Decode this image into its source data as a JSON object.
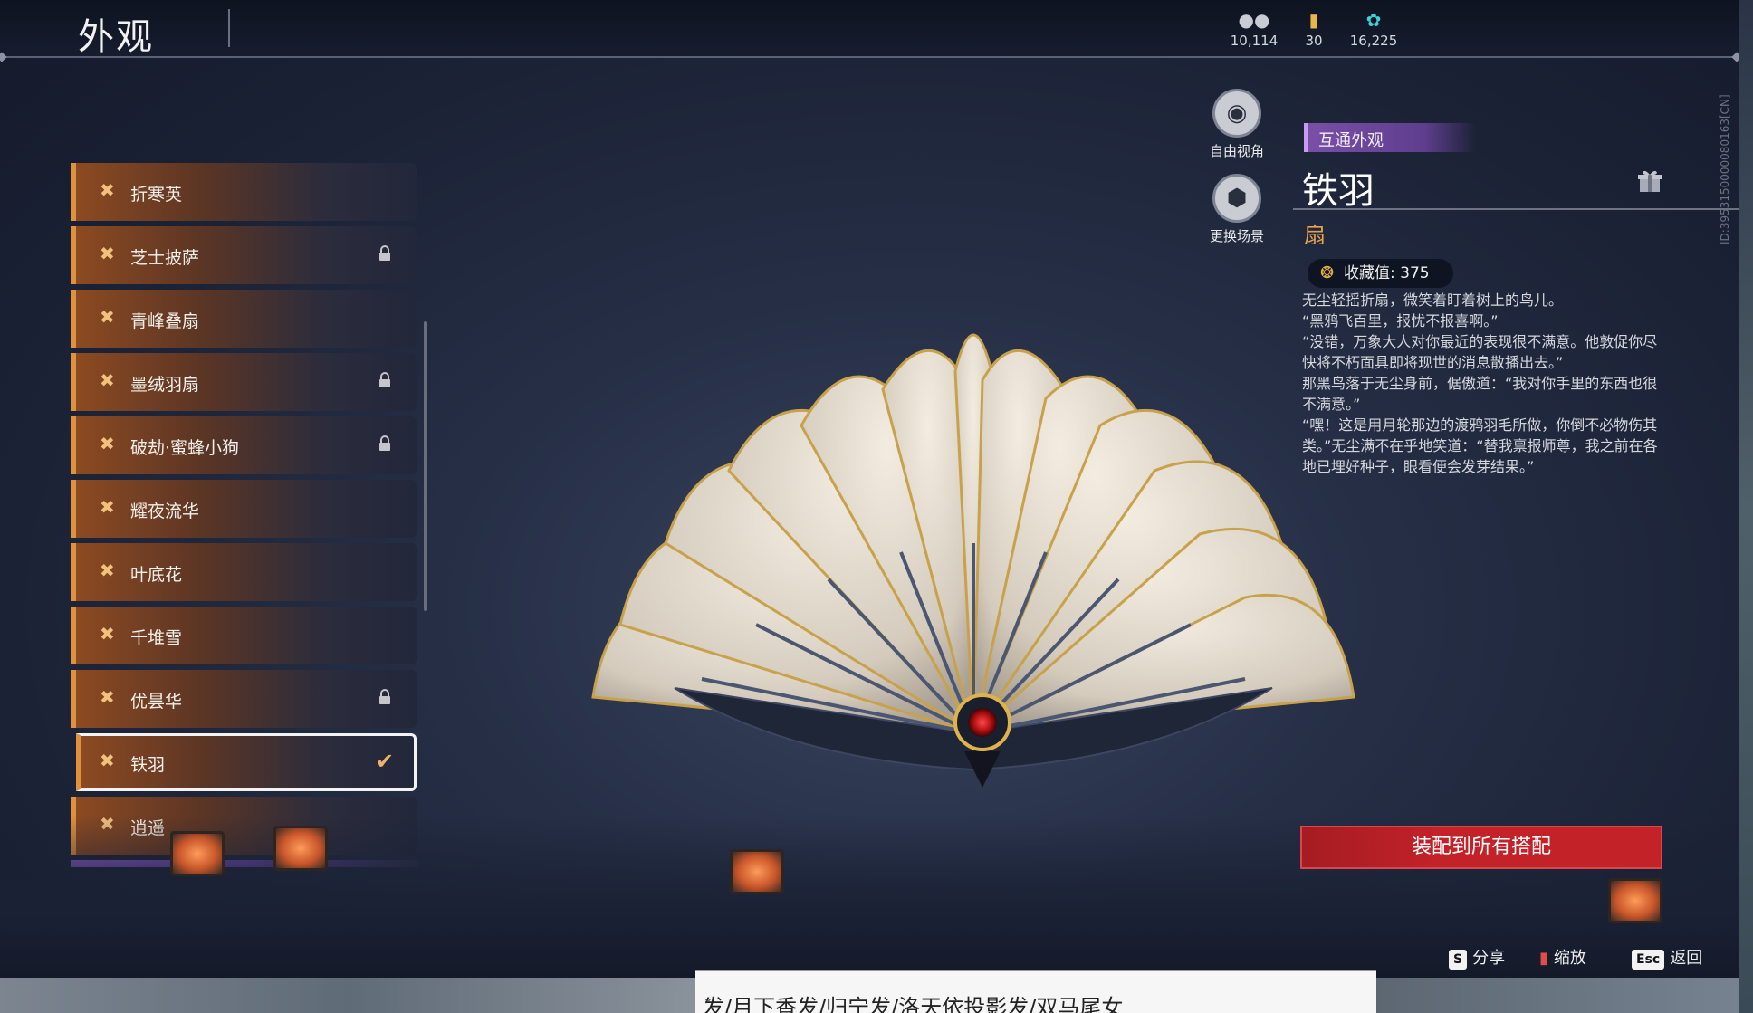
{
  "header": {
    "title": "外观"
  },
  "currencies": [
    {
      "icon": "coins-icon",
      "value": "10,114"
    },
    {
      "icon": "ticket-icon",
      "value": "30"
    },
    {
      "icon": "feather-icon",
      "value": "16,225"
    }
  ],
  "list": {
    "items": [
      {
        "label": "折寒英",
        "locked": false
      },
      {
        "label": "芝士披萨",
        "locked": true
      },
      {
        "label": "青峰叠扇",
        "locked": false
      },
      {
        "label": "墨绒羽扇",
        "locked": true
      },
      {
        "label": "破劫·蜜蜂小狗",
        "locked": true
      },
      {
        "label": "耀夜流华",
        "locked": false
      },
      {
        "label": "叶底花",
        "locked": false
      },
      {
        "label": "千堆雪",
        "locked": false
      },
      {
        "label": "优昙华",
        "locked": true
      },
      {
        "label": "铁羽",
        "locked": false,
        "selected": true
      },
      {
        "label": "逍遥",
        "locked": false
      }
    ]
  },
  "camera": {
    "free_view_label": "自由视角",
    "change_scene_label": "更换场景"
  },
  "detail": {
    "badge": "互通外观",
    "name": "铁羽",
    "type": "扇",
    "collect_label": "收藏值: 375",
    "description": "无尘轻摇折扇，微笑着盯着树上的鸟儿。\n“黑鸦飞百里，报忧不报喜啊。”\n“没错，万象大人对你最近的表现很不满意。他敦促你尽快将不朽面具即将现世的消息散播出去。”\n那黑鸟落于无尘身前，倨傲道：“我对你手里的东西也很不满意。”\n“嘿！这是用月轮那边的渡鸦羽毛所做，你倒不必物伤其类。”无尘满不在乎地笑道：“替我禀报师尊，我之前在各地已埋好种子，眼看便会发芽结果。”",
    "equip_label": "装配到所有搭配",
    "vertical_id": "ID:3953150000080163[CN]"
  },
  "footer": {
    "share_key": "S",
    "share_label": "分享",
    "zoom_label": "缩放",
    "back_key": "Esc",
    "back_label": "返回"
  },
  "overlay": {
    "text": "发/月下香发/归宁发/洛天依投影发/双马尾女"
  },
  "colors": {
    "accent": "#e0913d",
    "equip": "#c42229",
    "badge": "#7b4fa8"
  }
}
